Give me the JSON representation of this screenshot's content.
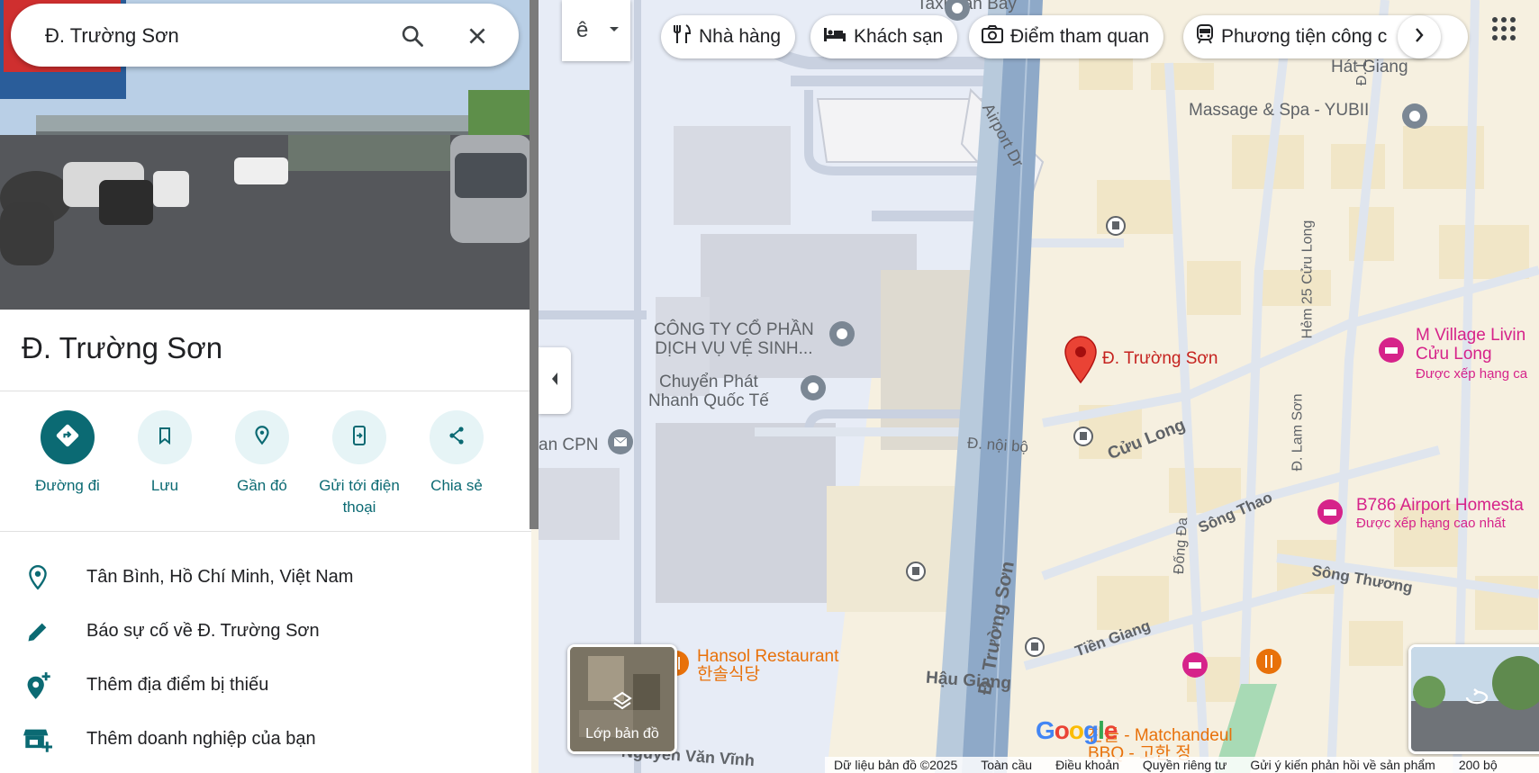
{
  "search": {
    "value": "Đ. Trường Sơn",
    "search_icon": "search-icon",
    "clear_icon": "close-icon"
  },
  "place": {
    "title": "Đ. Trường Sơn"
  },
  "actions": [
    {
      "label": "Đường đi",
      "icon": "directions-icon"
    },
    {
      "label": "Lưu",
      "icon": "bookmark-icon"
    },
    {
      "label": "Gần đó",
      "icon": "nearby-icon"
    },
    {
      "label": "Gửi tới điện thoại",
      "icon": "send-to-phone-icon"
    },
    {
      "label": "Chia sẻ",
      "icon": "share-icon"
    }
  ],
  "details": [
    {
      "text": "Tân Bình, Hồ Chí Minh, Việt Nam",
      "icon": "location-pin-icon"
    },
    {
      "text": "Báo sự cố về Đ. Trường Sơn",
      "icon": "pencil-icon"
    },
    {
      "text": "Thêm địa điểm bị thiếu",
      "icon": "add-location-icon"
    },
    {
      "text": "Thêm doanh nghiệp của bạn",
      "icon": "add-business-icon"
    }
  ],
  "chips": [
    {
      "label": "Nhà hàng",
      "icon": "restaurant-icon"
    },
    {
      "label": "Khách sạn",
      "icon": "hotel-icon"
    },
    {
      "label": "Điểm tham quan",
      "icon": "camera-icon"
    },
    {
      "label": "Phương tiện công c",
      "icon": "train-icon"
    }
  ],
  "map": {
    "labels": {
      "taxi": "Taxi Sân Bay",
      "hat_giang": "Hát Giang",
      "massage": "Massage & Spa - YUBII",
      "airport_dr": "Airport Dr",
      "congty_1": "CÔNG TY CỔ PHẦN",
      "congty_2": "DỊCH VỤ VỆ SINH...",
      "chuyen_1": "Chuyển Phát",
      "chuyen_2": "Nhanh Quốc Tế",
      "cpn": "an CPN",
      "truong_son_pin": "Đ. Trường Sơn",
      "hem25": "Hẻm 25 Cửu Long",
      "mvillage_1": "M Village Livin",
      "mvillage_2": "Cửu Long",
      "mvillage_3": "Được xếp hạng ca",
      "noi_bo": "Đ. nội bộ",
      "cuu_long": "Cửu Long",
      "lam_son": "Đ. Lam Sơn",
      "b786_1": "B786 Airport Homesta",
      "b786_2": "Được xếp hạng cao nhất",
      "song_thao": "Sông Thao",
      "dong_da": "Đống Đa",
      "song_thuong": "Sông Thương",
      "tien_giang": "Tiền Giang",
      "hansol_1": "Hansol Restaurant",
      "hansol_2": "한솔식당",
      "hau_giang": "Hậu Giang",
      "truong_son_road": "Đ. Trường Sơn",
      "nguyen_van_vinh": "Nguyễn Văn Vĩnh",
      "matchan_1": "찬들 - Matchandeul",
      "matchan_2": "BBQ - 고한 정",
      "d_l": "Đ. L"
    },
    "layer_button": "Lớp bản đồ",
    "google": "Google",
    "footer": [
      "Dữ liệu bản đồ ©2025",
      "Toàn cầu",
      "Điều khoản",
      "Quyền riêng tư",
      "Gửi ý kiến phản hồi về sản phẩm",
      "200 bộ"
    ],
    "input_tool_glyph": "ê",
    "colors": {
      "teal": "#0b6a73",
      "road_blue": "#8ea9c8",
      "pin_red": "#ea4335",
      "pink": "#d6238a",
      "orange": "#e8710a"
    }
  }
}
